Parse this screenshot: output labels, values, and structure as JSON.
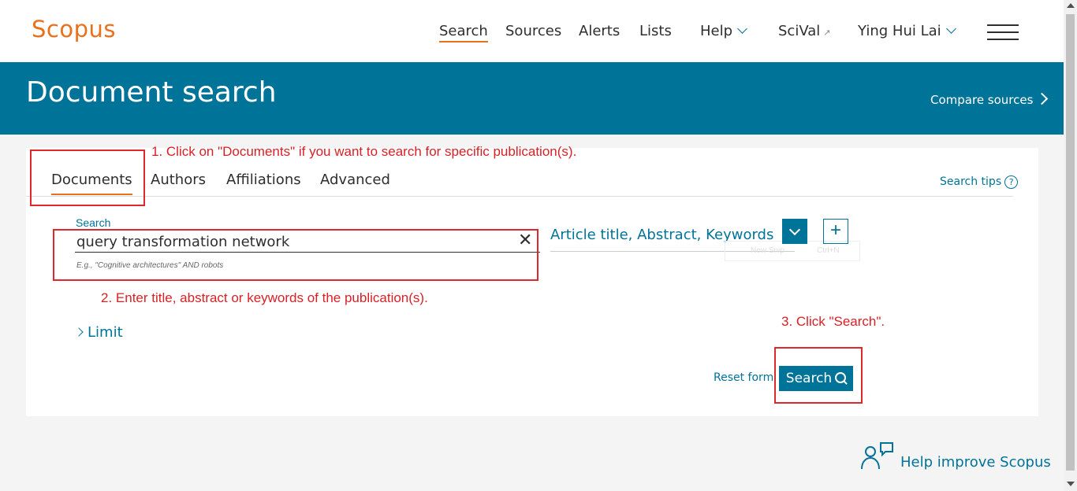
{
  "app": {
    "logo": "Scopus"
  },
  "nav": {
    "search": "Search",
    "sources": "Sources",
    "alerts": "Alerts",
    "lists": "Lists",
    "help": "Help",
    "scival": "SciVal",
    "scival_icon": "↗",
    "user": "Ying Hui Lai"
  },
  "banner": {
    "title": "Document search",
    "compare": "Compare sources"
  },
  "tabs": {
    "documents": "Documents",
    "authors": "Authors",
    "affiliations": "Affiliations",
    "advanced": "Advanced"
  },
  "search_tips": "Search tips",
  "form": {
    "field_label": "Search",
    "query": "query transformation network",
    "hint": "E.g., \"Cognitive architectures\" AND robots",
    "field_type": "Article title, Abstract, Keywords",
    "add": "+",
    "ghost_a": "New Snip",
    "ghost_b": "Ctrl+N",
    "limit": "Limit",
    "reset": "Reset form",
    "search_button": "Search"
  },
  "annotations": {
    "step1": "1. Click on \"Documents\" if you want to search for specific publication(s).",
    "step2": "2. Enter title, abstract or keywords of the publication(s).",
    "step3": "3. Click \"Search\"."
  },
  "feedback": {
    "label": "Help improve Scopus"
  },
  "colors": {
    "brand": "#e9711c",
    "primary": "#007398",
    "annotation": "#e0282c"
  }
}
